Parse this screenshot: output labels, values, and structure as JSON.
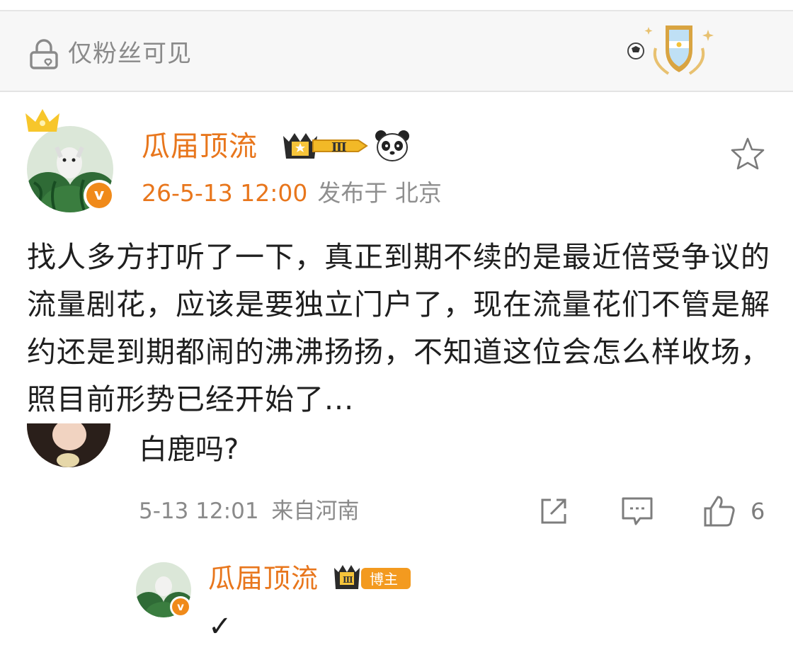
{
  "visibility": {
    "label": "仅粉丝可见",
    "icon": "lock-icon"
  },
  "post": {
    "author": "瓜届顶流",
    "level_badge": "Ⅲ",
    "timestamp": "26-5-13 12:00",
    "location": "发布于 北京",
    "text": "找人多方打听了一下，真正到期不续的是最近倍受争议的流量剧花，应该是要独立门户了，现在流量花们不管是解约还是到期都闹的沸沸扬扬，不知道这位会怎么样收场，照目前形势已经开始了...",
    "verified_mark": "v"
  },
  "comment": {
    "text": "白鹿吗?",
    "timestamp": "5-13 12:01",
    "location": "来自河南",
    "like_count": "6"
  },
  "reply": {
    "author": "瓜届顶流",
    "level_badge": "Ⅲ",
    "role_badge": "博主",
    "verified_mark": "v",
    "text": "✓"
  },
  "colors": {
    "accent": "#e8761c",
    "muted": "#8a8a8a",
    "badge_gold": "#f0b21c"
  }
}
